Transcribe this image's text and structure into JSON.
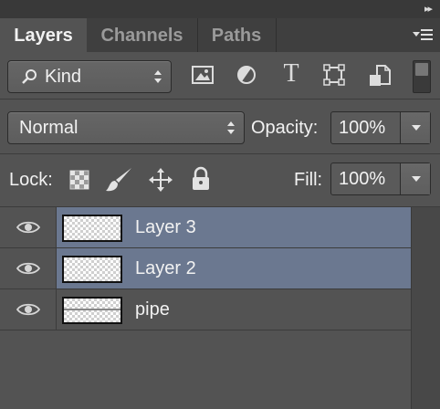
{
  "panel": {
    "collapse_glyph": "▸▸",
    "tabs": [
      {
        "label": "Layers",
        "active": true
      },
      {
        "label": "Channels",
        "active": false
      },
      {
        "label": "Paths",
        "active": false
      }
    ]
  },
  "filter": {
    "kind_label": "Kind",
    "icons": [
      "image-filter-icon",
      "adjustment-filter-icon",
      "type-filter-icon",
      "shape-filter-icon",
      "smart-object-filter-icon",
      "filter-toggle-icon"
    ],
    "type_glyph": "T"
  },
  "blend": {
    "mode": "Normal",
    "opacity_label": "Opacity:",
    "opacity_value": "100%"
  },
  "lock": {
    "label": "Lock:",
    "fill_label": "Fill:",
    "fill_value": "100%"
  },
  "layers": [
    {
      "name": "Layer 3",
      "selected": true,
      "visible": true
    },
    {
      "name": "Layer 2",
      "selected": true,
      "visible": true
    },
    {
      "name": "pipe",
      "selected": false,
      "visible": true
    }
  ],
  "colors": {
    "panel_bg": "#535353",
    "selection": "#6b7890",
    "tab_bar": "#3f3f3f"
  }
}
